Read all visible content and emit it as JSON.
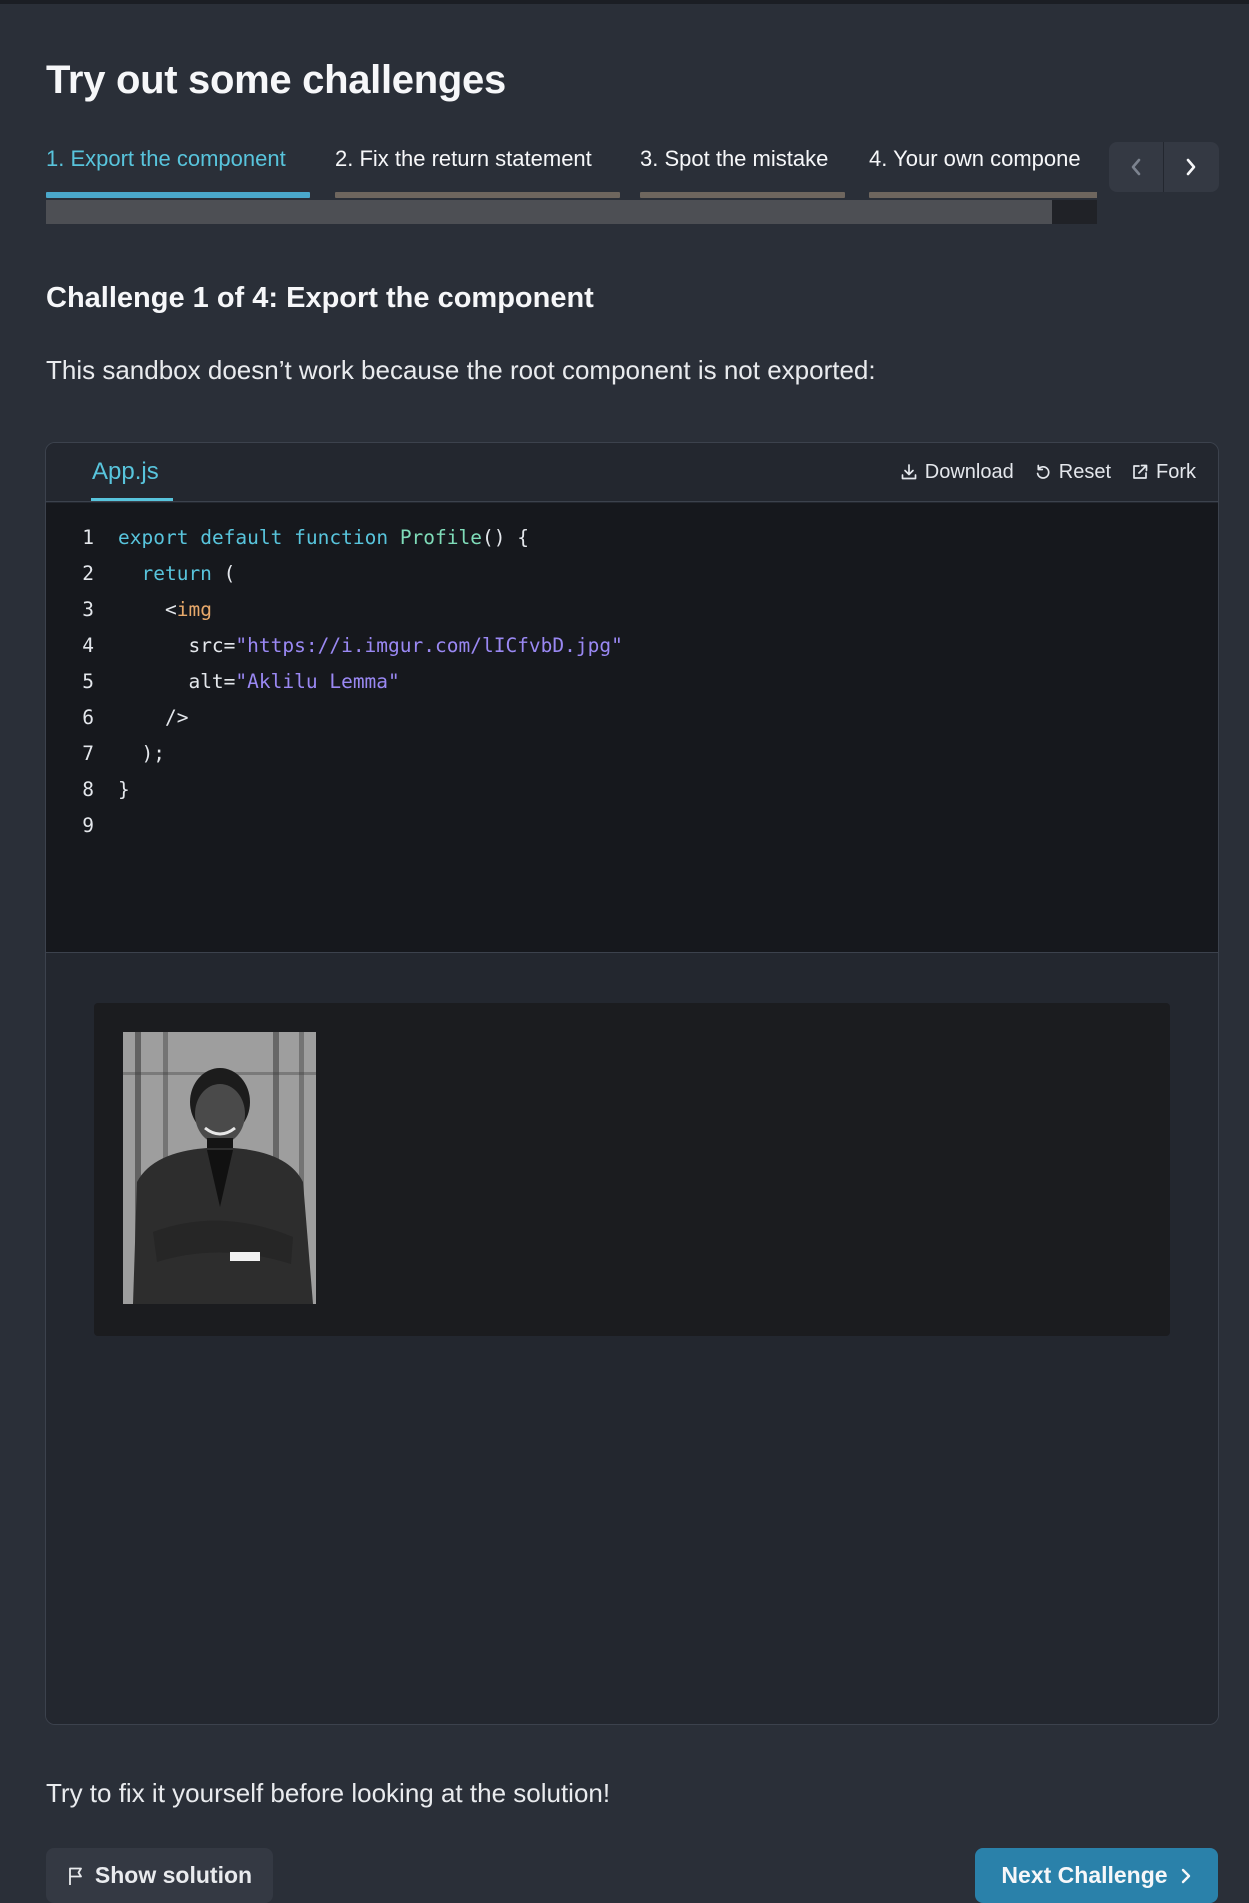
{
  "heading": "Try out some challenges",
  "tabs": [
    {
      "label": "1. Export the component",
      "active": true
    },
    {
      "label": "2. Fix the return statement",
      "active": false
    },
    {
      "label": "3. Spot the mistake",
      "active": false
    },
    {
      "label": "4. Your own compone",
      "active": false
    }
  ],
  "nav": {
    "prev_icon": "chevron-left-icon",
    "next_icon": "chevron-right-icon"
  },
  "challenge": {
    "counter": "Challenge 1 of 4:",
    "title": "Export the component",
    "description": "This sandbox doesn’t work because the root component is not exported:"
  },
  "sandbox": {
    "file_tab": "App.js",
    "actions": {
      "download": "Download",
      "reset": "Reset",
      "fork": "Fork"
    },
    "code": {
      "line_numbers": [
        "1",
        "2",
        "3",
        "4",
        "5",
        "6",
        "7",
        "8",
        "9"
      ],
      "l1": {
        "kw1": "export",
        "kw2": "default",
        "kw3": "function",
        "fn": "Profile",
        "rest": "() {"
      },
      "l2": {
        "indent": "  ",
        "kw": "return",
        "rest": " ("
      },
      "l3": {
        "indent": "    ",
        "open": "<",
        "tag": "img"
      },
      "l4": {
        "indent": "      ",
        "attr": "src=",
        "val": "\"https://i.imgur.com/lICfvbD.jpg\""
      },
      "l5": {
        "indent": "      ",
        "attr": "alt=",
        "val": "\"Aklilu Lemma\""
      },
      "l6": {
        "text": "    />"
      },
      "l7": {
        "text": "  );"
      },
      "l8": {
        "text": "}"
      }
    },
    "preview": {
      "image_alt": "Aklilu Lemma"
    }
  },
  "hint": "Try to fix it yourself before looking at the solution!",
  "buttons": {
    "show_solution": "Show solution",
    "next_challenge": "Next Challenge"
  },
  "colors": {
    "accent": "#58c4dc",
    "primary_button": "#2a81aa",
    "background": "#2a2f38"
  }
}
